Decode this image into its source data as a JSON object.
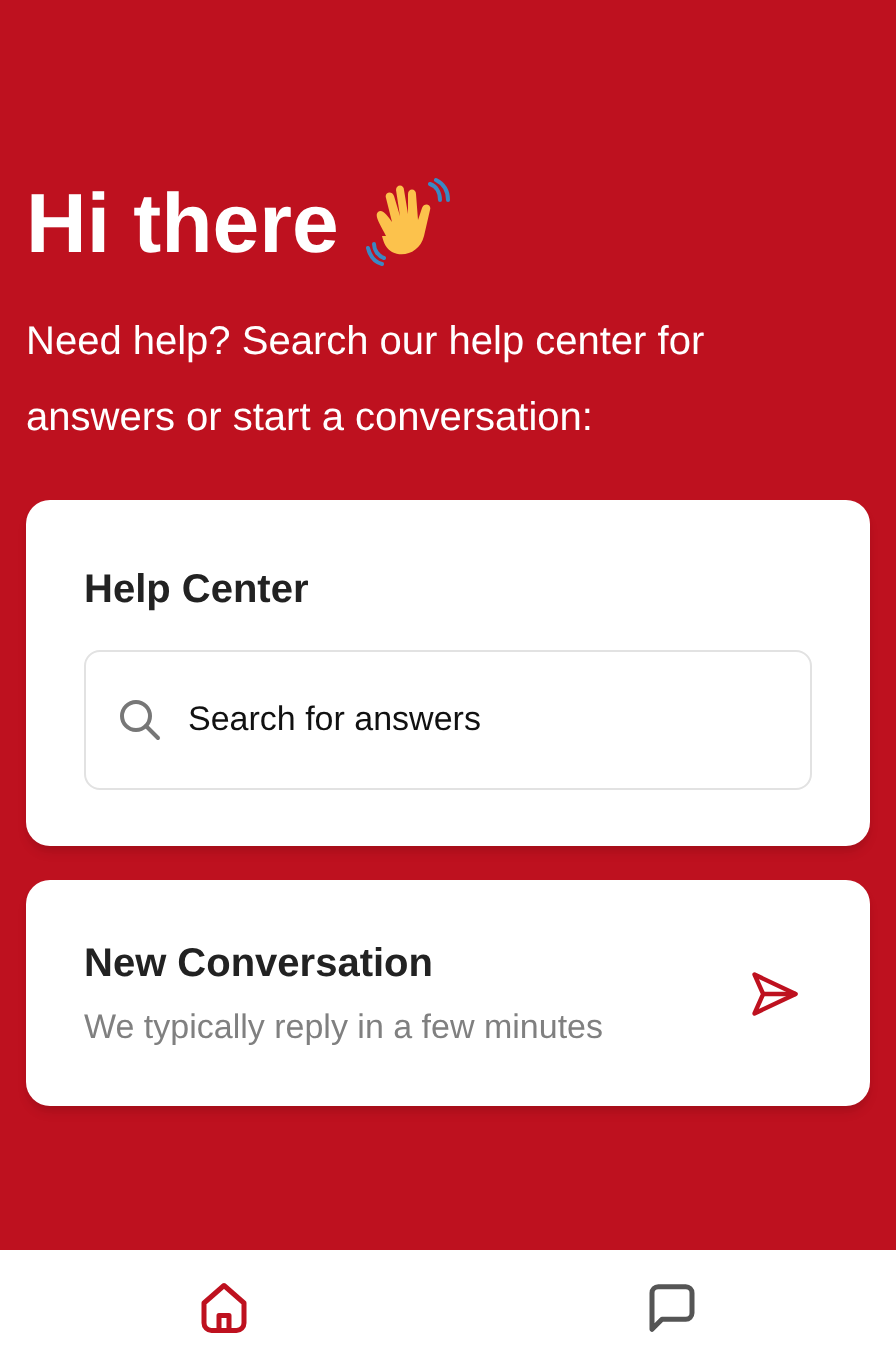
{
  "greeting": {
    "title": "Hi there",
    "subtitle": "Need help? Search our help center for answers or start a conversation:"
  },
  "help_center": {
    "title": "Help Center",
    "search": {
      "placeholder": "Search for answers"
    }
  },
  "new_conversation": {
    "title": "New Conversation",
    "subtitle": "We typically reply in a few minutes"
  },
  "nav": [
    {
      "kind": "home",
      "selected": true
    },
    {
      "kind": "messages",
      "selected": false
    }
  ]
}
